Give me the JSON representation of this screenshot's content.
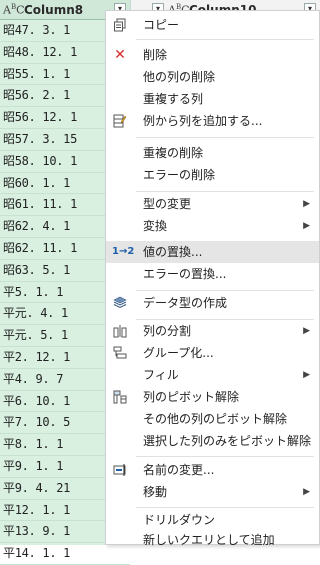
{
  "grid": {
    "column8": {
      "type_icon": "ABC",
      "title": "Column8"
    },
    "column10": {
      "type_icon": "ABC",
      "title": "Column10"
    },
    "rows": [
      "昭47. 3. 1",
      "昭48. 12. 1",
      "昭55. 1. 1",
      "昭56. 2. 1",
      "昭56. 12. 1",
      "昭57. 3. 15",
      "昭58. 10. 1",
      "昭60. 1. 1",
      "昭61. 11. 1",
      "昭62. 4. 1",
      "昭62. 11. 1",
      "昭63. 5. 1",
      "平5. 1. 1",
      "平元. 4. 1",
      "平元. 5. 1",
      "平2. 12. 1",
      "平4. 9. 7",
      "平6. 10. 1",
      "平7. 10. 5",
      "平8. 1. 1",
      "平9. 1. 1",
      "平9. 4. 21",
      "平12. 1. 1",
      "平13. 9. 1",
      "平14. 1. 1"
    ]
  },
  "menu": {
    "items": [
      {
        "label": "コピー",
        "icon": "copy-icon"
      },
      {
        "label": "削除",
        "icon": "delete-x-icon"
      },
      {
        "label": "他の列の削除"
      },
      {
        "label": "重複する列"
      },
      {
        "label": "例から列を追加する...",
        "icon": "add-column-example-icon"
      },
      {
        "label": "重複の削除"
      },
      {
        "label": "エラーの削除"
      },
      {
        "label": "型の変更",
        "submenu": true
      },
      {
        "label": "変換",
        "submenu": true
      },
      {
        "label": "値の置換...",
        "icon": "replace-values-icon",
        "highlighted": true
      },
      {
        "label": "エラーの置換..."
      },
      {
        "label": "データ型の作成",
        "icon": "data-type-icon"
      },
      {
        "label": "列の分割",
        "icon": "split-column-icon",
        "submenu": true
      },
      {
        "label": "グループ化...",
        "icon": "group-by-icon"
      },
      {
        "label": "フィル",
        "submenu": true
      },
      {
        "label": "列のピボット解除",
        "icon": "unpivot-icon"
      },
      {
        "label": "その他の列のピボット解除"
      },
      {
        "label": "選択した列のみをピボット解除"
      },
      {
        "label": "名前の変更...",
        "icon": "rename-icon"
      },
      {
        "label": "移動",
        "submenu": true
      },
      {
        "label": "ドリルダウン"
      },
      {
        "label": "新しいクエリとして追加"
      }
    ],
    "replace_icon_text": "1→2"
  }
}
